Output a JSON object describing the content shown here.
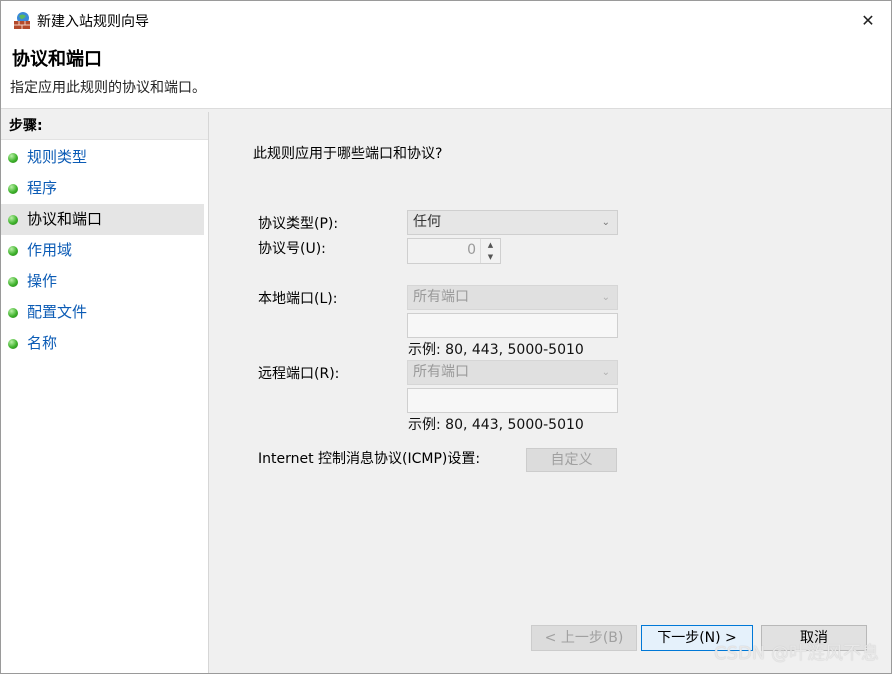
{
  "window": {
    "title": "新建入站规则向导",
    "close_glyph": "✕"
  },
  "header": {
    "title": "协议和端口",
    "description": "指定应用此规则的协议和端口。"
  },
  "sidebar": {
    "steps_title": "步骤:",
    "items": [
      {
        "label": "规则类型"
      },
      {
        "label": "程序"
      },
      {
        "label": "协议和端口",
        "active": true
      },
      {
        "label": "作用域"
      },
      {
        "label": "操作"
      },
      {
        "label": "配置文件"
      },
      {
        "label": "名称"
      }
    ]
  },
  "main": {
    "question": "此规则应用于哪些端口和协议?",
    "protocol_type": {
      "label": "协议类型(P):",
      "value": "任何"
    },
    "protocol_number": {
      "label": "协议号(U):",
      "value": "0"
    },
    "local_port": {
      "label": "本地端口(L):",
      "value": "所有端口",
      "input": "",
      "example": "示例: 80, 443, 5000-5010"
    },
    "remote_port": {
      "label": "远程端口(R):",
      "value": "所有端口",
      "input": "",
      "example": "示例: 80, 443, 5000-5010"
    },
    "icmp": {
      "label": "Internet 控制消息协议(ICMP)设置:",
      "button": "自定义"
    }
  },
  "footer": {
    "back": "< 上一步(B)",
    "next": "下一步(N) >",
    "cancel": "取消"
  },
  "watermark": "CSDN @叶涟风不息",
  "colors": {
    "link": "#0b5bb5",
    "accent": "#0078d7",
    "dot": "#3fb32c"
  }
}
